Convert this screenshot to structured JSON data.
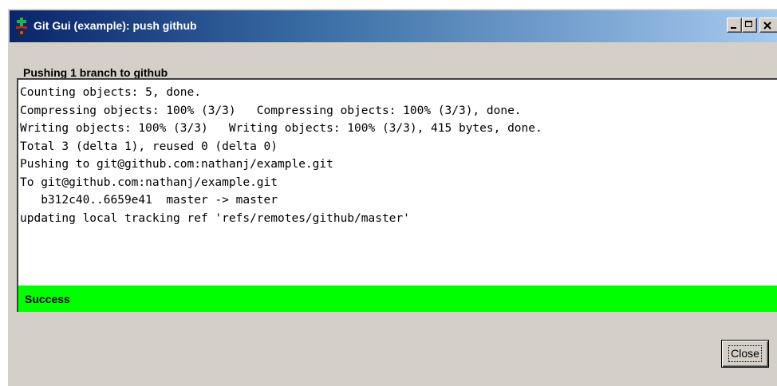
{
  "window": {
    "title": "Git Gui (example): push github",
    "icon": "git-gui-icon"
  },
  "titlebar_buttons": {
    "minimize_icon": "minimize-icon",
    "maximize_icon": "maximize-icon",
    "close_icon": "close-icon"
  },
  "heading": "Pushing 1 branch to github",
  "console": {
    "lines": [
      "Counting objects: 5, done.",
      "Compressing objects: 100% (3/3)   Compressing objects: 100% (3/3), done.",
      "Writing objects: 100% (3/3)   Writing objects: 100% (3/3), 415 bytes, done.",
      "Total 3 (delta 1), reused 0 (delta 0)",
      "Pushing to git@github.com:nathanj/example.git",
      "To git@github.com:nathanj/example.git",
      "   b312c40..6659e41  master -> master",
      "updating local tracking ref 'refs/remotes/github/master'"
    ]
  },
  "status": {
    "text": "Success",
    "color": "#00ff00"
  },
  "buttons": {
    "close_label": "Close"
  },
  "colors": {
    "titlebar_start": "#0a246a",
    "titlebar_end": "#a6caf0",
    "window_face": "#d4d0c8"
  }
}
